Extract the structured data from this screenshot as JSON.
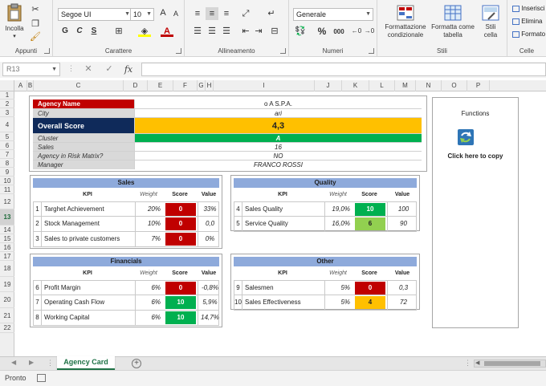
{
  "ribbon": {
    "clipboard": {
      "paste_label": "Incolla",
      "group_label": "Appunti"
    },
    "font": {
      "font_name": "Segoe UI",
      "font_size": "10",
      "grow_label": "A",
      "shrink_label": "A",
      "bold_label": "G",
      "italic_label": "C",
      "underline_label": "S",
      "group_label": "Carattere"
    },
    "alignment": {
      "group_label": "Allineamento"
    },
    "number": {
      "format": "Generale",
      "percent_label": "%",
      "thousands_label": "000",
      "group_label": "Numeri"
    },
    "styles": {
      "conditional_label_1": "Formattazione",
      "conditional_label_2": "condizionale",
      "table_label_1": "Formatta come",
      "table_label_2": "tabella",
      "cell_styles_label_1": "Stili",
      "cell_styles_label_2": "cella",
      "group_label": "Stili"
    },
    "cells": {
      "insert_label": "Inserisci",
      "delete_label": "Elimina",
      "format_label": "Formato",
      "group_label": "Celle"
    }
  },
  "formula_bar": {
    "name_box": "R13",
    "cancel_icon": "✕",
    "enter_icon": "✓",
    "fx_label": "fx",
    "formula": ""
  },
  "grid": {
    "columns": [
      "A",
      "B",
      "C",
      "D",
      "E",
      "F",
      "G",
      "H",
      "I",
      "J",
      "K",
      "L",
      "M",
      "N",
      "O",
      "P"
    ],
    "rows": [
      "1",
      "2",
      "3",
      "4",
      "5",
      "6",
      "7",
      "8",
      "9",
      "10",
      "11",
      "12",
      "13",
      "14",
      "15",
      "16",
      "17",
      "18",
      "19",
      "20",
      "21",
      "22"
    ],
    "selected_row": "13"
  },
  "agency": {
    "name_label": "Agency Name",
    "name_value": "o A S.P.A.",
    "city_label": "City",
    "city_value": "ari",
    "score_label": "Overall Score",
    "score_value": "4,3",
    "cluster_label": "Cluster",
    "cluster_value": "A",
    "sales_label": "Sales",
    "sales_value": "16",
    "risk_label": "Agency in Risk Matrix?",
    "risk_value": "NO",
    "manager_label": "Manager",
    "manager_value": "FRANCO ROSSI"
  },
  "kpi_headers": {
    "kpi": "KPI",
    "weight": "Weight",
    "score": "Score",
    "value": "Value"
  },
  "panels": {
    "sales": {
      "title": "Sales",
      "rows": [
        {
          "num": "1",
          "name": "Targhet Achievement",
          "weight": "20%",
          "score": "0",
          "value": "33%"
        },
        {
          "num": "2",
          "name": "Stock Management",
          "weight": "10%",
          "score": "0",
          "value": "0,0"
        },
        {
          "num": "3",
          "name": "Sales to private customers",
          "weight": "7%",
          "score": "0",
          "value": "0%"
        }
      ]
    },
    "quality": {
      "title": "Quality",
      "rows": [
        {
          "num": "4",
          "name": "Sales Quality",
          "weight": "19,0%",
          "score": "10",
          "value": "100"
        },
        {
          "num": "5",
          "name": "Service Quality",
          "weight": "16,0%",
          "score": "6",
          "value": "90"
        }
      ]
    },
    "financials": {
      "title": "Financials",
      "rows": [
        {
          "num": "6",
          "name": "Profit Margin",
          "weight": "6%",
          "score": "0",
          "value": "-0,8%"
        },
        {
          "num": "7",
          "name": "Operating Cash Flow",
          "weight": "6%",
          "score": "10",
          "value": "5,9%"
        },
        {
          "num": "8",
          "name": "Working Capital",
          "weight": "6%",
          "score": "10",
          "value": "14,7%"
        }
      ]
    },
    "other": {
      "title": "Other",
      "rows": [
        {
          "num": "9",
          "name": "Salesmen",
          "weight": "5%",
          "score": "0",
          "value": "0,3"
        },
        {
          "num": "10",
          "name": "Sales Effectiveness",
          "weight": "5%",
          "score": "4",
          "value": "72"
        }
      ]
    }
  },
  "functions": {
    "title": "Functions",
    "copy_label": "Click here to copy"
  },
  "tabs": {
    "active_sheet": "Agency Card",
    "add_label": "+"
  },
  "status": {
    "ready": "Pronto"
  },
  "colors": {
    "red": "#c00000",
    "navy": "#0f2a5a",
    "green": "#00b050",
    "light_green": "#92d050",
    "yellow": "#ffc000",
    "panel_header": "#8eaadb",
    "excel_green": "#1e7145"
  }
}
